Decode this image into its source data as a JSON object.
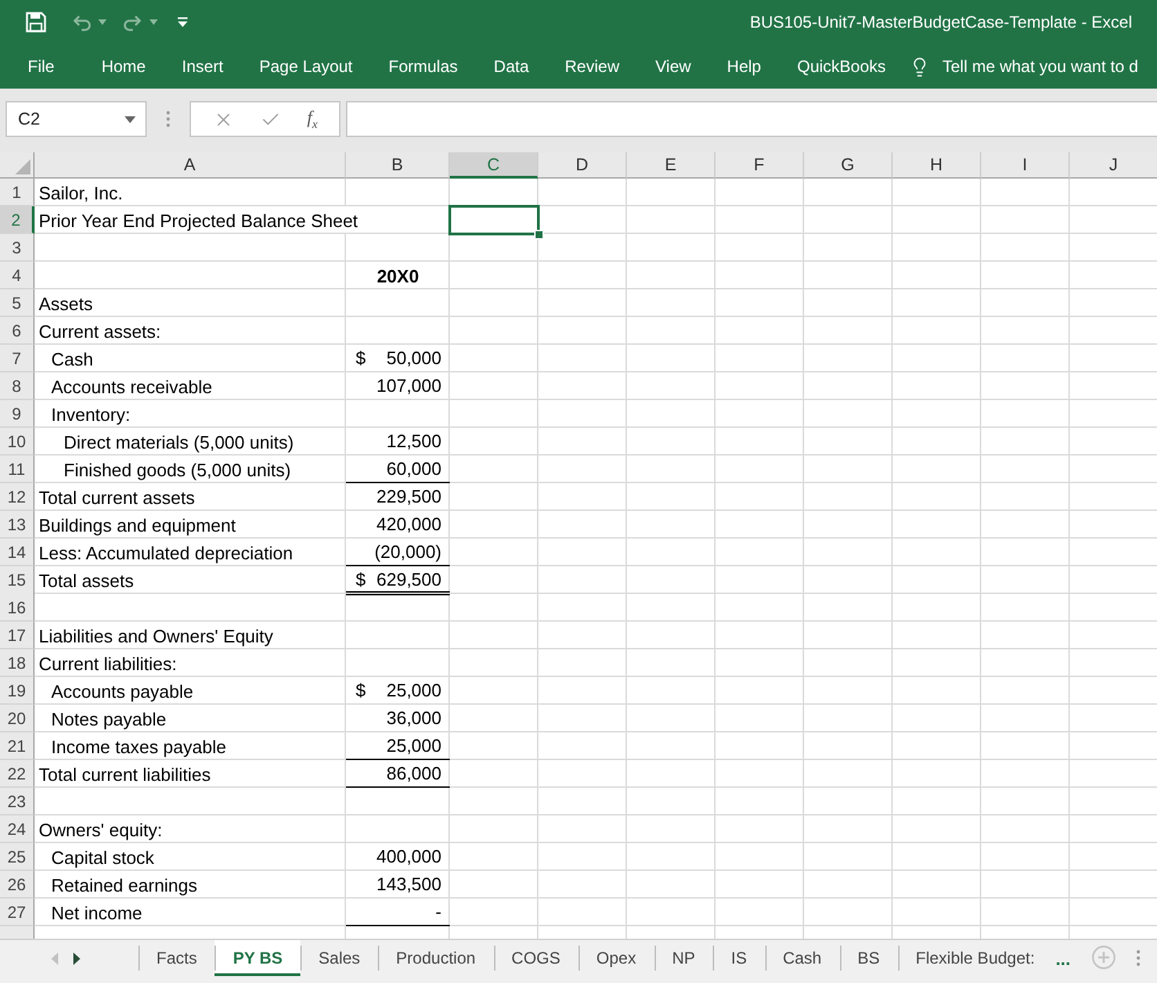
{
  "title_bar": {
    "title": "BUS105-Unit7-MasterBudgetCase-Template - Excel",
    "undo": {
      "disabled": true
    },
    "redo": {
      "disabled": true
    }
  },
  "ribbon_tabs": [
    {
      "label": "File",
      "selected": false
    },
    {
      "label": "Home",
      "selected": false
    },
    {
      "label": "Insert",
      "selected": false
    },
    {
      "label": "Page Layout",
      "selected": false
    },
    {
      "label": "Formulas",
      "selected": false
    },
    {
      "label": "Data",
      "selected": false
    },
    {
      "label": "Review",
      "selected": false
    },
    {
      "label": "View",
      "selected": false
    },
    {
      "label": "Help",
      "selected": false
    },
    {
      "label": "QuickBooks",
      "selected": false
    }
  ],
  "tell_me": {
    "placeholder": "Tell me what you want to d"
  },
  "formula_bar": {
    "name_box": "C2",
    "insert_function": "f$_{x}$"
  },
  "sheet": {
    "columns": [
      {
        "label": "A",
        "selected": false
      },
      {
        "label": "B",
        "selected": false
      },
      {
        "label": "C",
        "selected": true
      },
      {
        "label": "D",
        "selected": false
      },
      {
        "label": "E",
        "selected": false
      },
      {
        "label": "F",
        "selected": false
      },
      {
        "label": "G",
        "selected": false
      },
      {
        "label": "H",
        "selected": false
      },
      {
        "label": "I",
        "selected": false
      },
      {
        "label": "J",
        "selected": false
      }
    ],
    "rows": [
      {
        "number": "1",
        "a": "Sailor, Inc.",
        "selected": false
      },
      {
        "number": "2",
        "a": "Prior Year End Projected Balance Sheet",
        "selected": true
      },
      {
        "number": "3",
        "selected": false
      },
      {
        "number": "4",
        "b": {
          "kind": "heading",
          "text": "20X0"
        },
        "selected": false
      },
      {
        "number": "5",
        "a": "Assets",
        "selected": false
      },
      {
        "number": "6",
        "a": "Current assets:",
        "selected": false,
        "children": [
          {
            "number": "7",
            "a": "Cash",
            "b": {
              "kind": "amount",
              "symbol": "$",
              "text": "50,000",
              "underline": false,
              "double_underline": false
            },
            "selected": false
          },
          {
            "number": "8",
            "a": "Accounts receivable",
            "b": {
              "kind": "amount",
              "text": "107,000",
              "underline": false,
              "double_underline": false
            },
            "selected": false
          },
          {
            "number": "9",
            "a": "Inventory:",
            "selected": false,
            "children": [
              {
                "number": "10",
                "a": "Direct materials (5,000 units)",
                "b": {
                  "kind": "amount",
                  "text": "12,500",
                  "underline": false,
                  "double_underline": false
                },
                "selected": false
              },
              {
                "number": "11",
                "a": "Finished goods (5,000 units)",
                "b": {
                  "kind": "amount",
                  "text": "60,000",
                  "underline": true,
                  "double_underline": false
                },
                "selected": false
              }
            ]
          }
        ]
      },
      {
        "number": "12",
        "a": "Total current assets",
        "b": {
          "kind": "amount",
          "text": "229,500",
          "underline": false,
          "double_underline": false
        },
        "selected": false
      },
      {
        "number": "13",
        "a": "Buildings and equipment",
        "b": {
          "kind": "amount",
          "text": "420,000",
          "underline": false,
          "double_underline": false
        },
        "selected": false
      },
      {
        "number": "14",
        "a": "Less: Accumulated depreciation",
        "b": {
          "kind": "amount",
          "text": "(20,000)",
          "underline": true,
          "double_underline": false
        },
        "selected": false
      },
      {
        "number": "15",
        "a": "Total assets",
        "b": {
          "kind": "amount",
          "symbol": "$",
          "text": "629,500",
          "underline": false,
          "double_underline": true
        },
        "selected": false
      },
      {
        "number": "16",
        "selected": false
      },
      {
        "number": "17",
        "a": "Liabilities and Owners' Equity",
        "selected": false
      },
      {
        "number": "18",
        "a": "Current liabilities:",
        "selected": false,
        "children": [
          {
            "number": "19",
            "a": "Accounts payable",
            "b": {
              "kind": "amount",
              "symbol": "$",
              "text": "25,000",
              "underline": false,
              "double_underline": false
            },
            "selected": false
          },
          {
            "number": "20",
            "a": "Notes payable",
            "b": {
              "kind": "amount",
              "text": "36,000",
              "underline": false,
              "double_underline": false
            },
            "selected": false
          },
          {
            "number": "21",
            "a": "Income taxes payable",
            "b": {
              "kind": "amount",
              "text": "25,000",
              "underline": true,
              "double_underline": false
            },
            "selected": false
          }
        ]
      },
      {
        "number": "22",
        "a": "Total current liabilities",
        "b": {
          "kind": "amount",
          "text": "86,000",
          "underline": true,
          "double_underline": false
        },
        "selected": false
      },
      {
        "number": "23",
        "selected": false
      },
      {
        "number": "24",
        "a": "Owners' equity:",
        "selected": false,
        "children": [
          {
            "number": "25",
            "a": "Capital stock",
            "b": {
              "kind": "amount",
              "text": "400,000",
              "underline": false,
              "double_underline": false
            },
            "selected": false
          },
          {
            "number": "26",
            "a": "Retained earnings",
            "b": {
              "kind": "amount",
              "text": "143,500",
              "underline": false,
              "double_underline": false
            },
            "selected": false
          },
          {
            "number": "27",
            "a": "Net income",
            "b": {
              "kind": "amount",
              "text": "-",
              "underline": true,
              "double_underline": false
            },
            "selected": false
          }
        ]
      }
    ]
  },
  "sheet_tabs": {
    "scroll_left": {
      "disabled": true
    },
    "scroll_right": {
      "disabled": false
    },
    "tabs": [
      {
        "label": "Facts",
        "selected": false
      },
      {
        "label": "PY BS",
        "selected": true
      },
      {
        "label": "Sales",
        "selected": false
      },
      {
        "label": "Production",
        "selected": false
      },
      {
        "label": "COGS",
        "selected": false
      },
      {
        "label": "Opex",
        "selected": false
      },
      {
        "label": "NP",
        "selected": false
      },
      {
        "label": "IS",
        "selected": false
      },
      {
        "label": "Cash",
        "selected": false
      },
      {
        "label": "BS",
        "selected": false
      },
      {
        "label": "Flexible Budget:",
        "selected": false
      }
    ],
    "more": "..."
  }
}
